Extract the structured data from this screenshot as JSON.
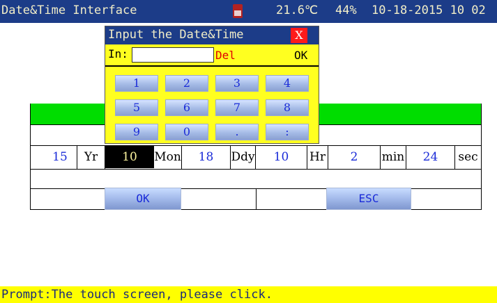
{
  "titlebar": {
    "title": "Date&Time Interface",
    "temperature": "21.6℃",
    "humidity": "44%",
    "datetime": "10-18-2015 10 02"
  },
  "datetime_row": [
    {
      "value": "15",
      "unit": "Yr"
    },
    {
      "value": "10",
      "unit": "Mon",
      "selected": true
    },
    {
      "value": "18",
      "unit": "Ddy"
    },
    {
      "value": "10",
      "unit": "Hr"
    },
    {
      "value": "2",
      "unit": "min"
    },
    {
      "value": "24",
      "unit": "sec"
    }
  ],
  "buttons": {
    "ok": "OK",
    "esc": "ESC"
  },
  "popup": {
    "title": "Input the Date&Time",
    "close": "X",
    "input_label": "In:",
    "input_value": "",
    "del": "Del",
    "ok": "OK",
    "keys": [
      "1",
      "2",
      "3",
      "4",
      "5",
      "6",
      "7",
      "8",
      "9",
      "0",
      ".",
      ":"
    ]
  },
  "prompt": "Prompt:The touch screen, please click.",
  "colors": {
    "titlebar": "#1c3c88",
    "green_bar": "#00dd00",
    "popup_bg": "#ffff20",
    "prompt_bg": "#ffff00",
    "value_text": "#1a2bd8"
  }
}
